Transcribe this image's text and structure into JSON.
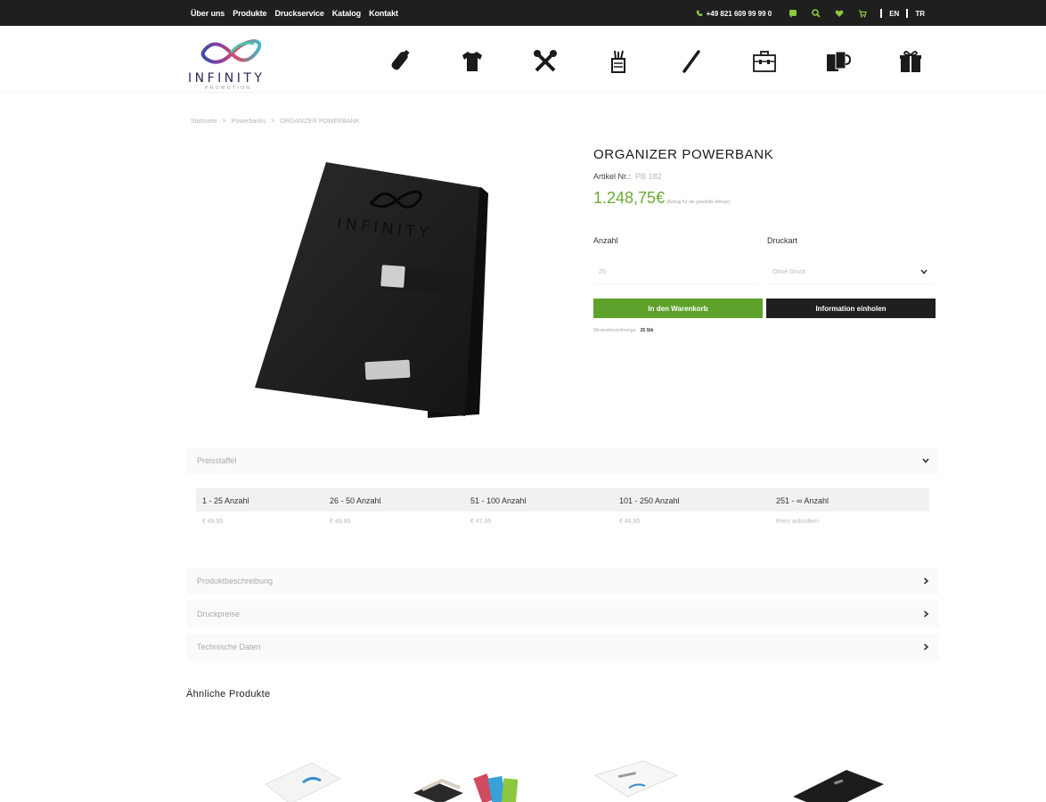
{
  "topbar": {
    "nav": [
      "Über uns",
      "Produkte",
      "Druckservice",
      "Katalog",
      "Kontakt"
    ],
    "phone": "+49 821 609 99 99 0",
    "icons": [
      "whatsapp-icon",
      "search-icon",
      "heart-icon",
      "cart-icon"
    ],
    "languages": [
      "EN",
      "TR"
    ],
    "colors": {
      "background": "#1f1f1f",
      "accent": "#8dc63f"
    }
  },
  "header": {
    "logo_text": "INFINITY",
    "logo_subtext": "PROMOTION",
    "categories": [
      "usb-stick-icon",
      "t-shirt-icon",
      "tools-icon",
      "pen-holder-icon",
      "pen-icon",
      "briefcase-icon",
      "mugs-icon",
      "gift-icon"
    ]
  },
  "breadcrumb": [
    "Startseite",
    "Powerbanks",
    "ORGANIZER POWERBANK"
  ],
  "product": {
    "title": "ORGANIZER POWERBANK",
    "article_label": "Artikel Nr.:",
    "article_value": "PB 182",
    "price": "1.248,75€",
    "price_note": "(Betrag für die gewählte Menge)",
    "quantity_label": "Anzahl",
    "quantity_value": "25",
    "print_label": "Druckart",
    "print_value": "Ohne Druck",
    "cart_button": "In den Warenkorb",
    "info_button": "Information einholen",
    "stock_label": "Mindestbestellmenge:",
    "stock_value": "25 Stk",
    "colors": {
      "price": "#6aab35",
      "cart": "#5ea22c"
    }
  },
  "price_tiers": {
    "title": "Preisstaffel",
    "headers": [
      "1 - 25 Anzahl",
      "26 - 50 Anzahl",
      "51 - 100 Anzahl",
      "101 - 250 Anzahl",
      "251 - ∞ Anzahl"
    ],
    "values": [
      "€ 49,95",
      "€ 48,95",
      "€ 47,95",
      "€ 46,95",
      "Preis anfordern"
    ]
  },
  "accordions": [
    "Produktbeschreibung",
    "Druckpreise",
    "Technische Daten"
  ],
  "related": {
    "title": "Ähnliche Produkte"
  }
}
